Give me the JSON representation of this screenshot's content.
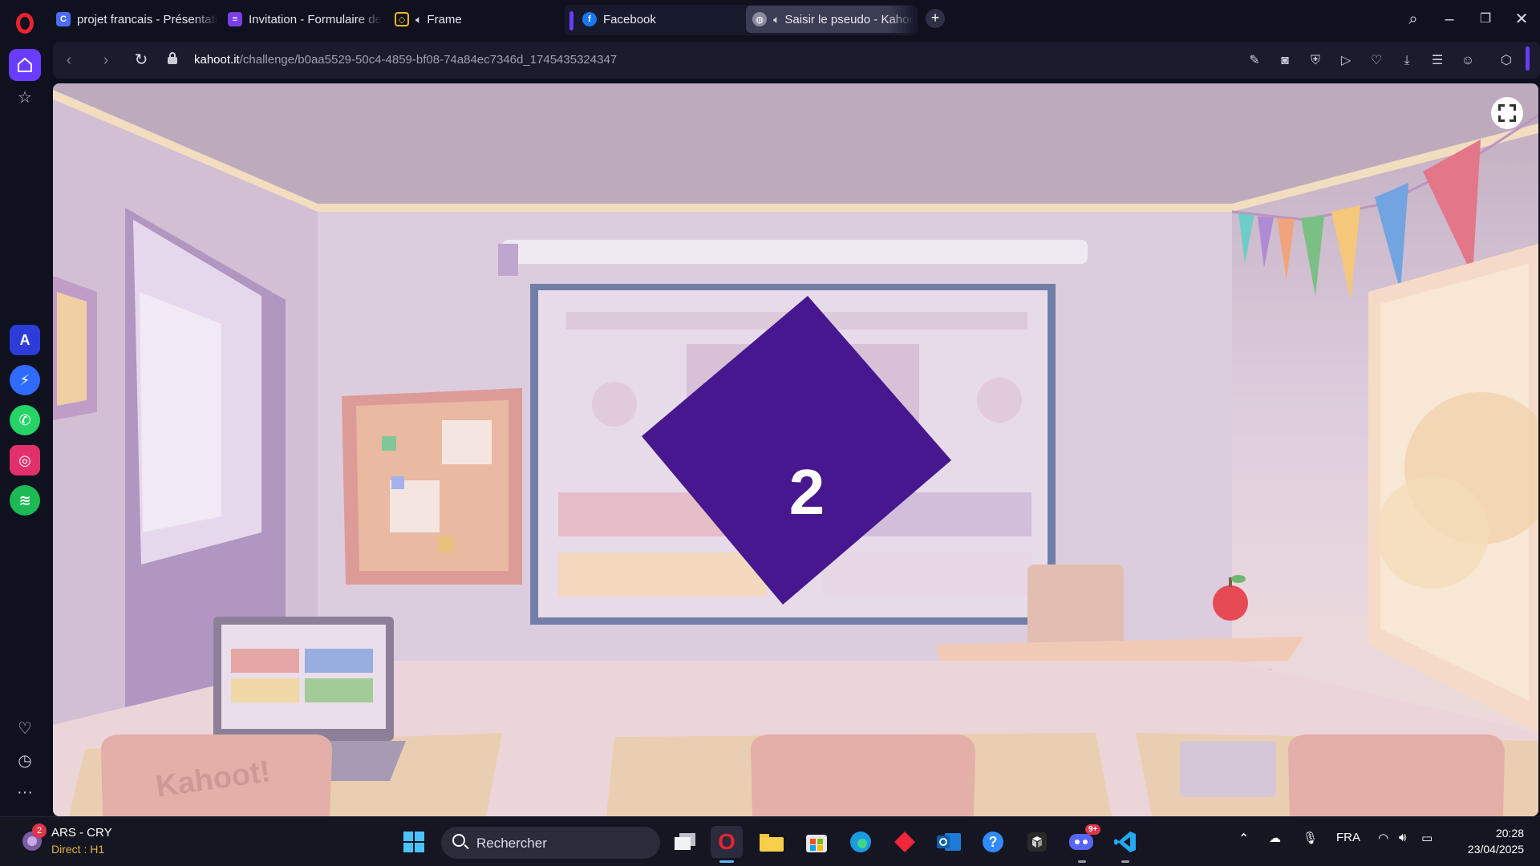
{
  "browser": {
    "tabs": [
      {
        "label": "projet francais - Présentati",
        "icon": "canva-icon",
        "color": "#4a6cf7"
      },
      {
        "label": "Invitation - Formulaire de",
        "icon": "forms-icon",
        "color": "#7b3fe4"
      },
      {
        "label": "Frame",
        "icon": "frame-icon",
        "color": "#f2b91c"
      },
      {
        "label": "Facebook",
        "icon": "facebook-icon",
        "color": "#1877f2"
      },
      {
        "label": "Saisir le pseudo - Kahoot",
        "icon": "globe-icon",
        "color": "#8a8c9e"
      }
    ],
    "active_tab_index": 4,
    "url_host": "kahoot.it",
    "url_path": "/challenge/b0aa5529-50c4-4859-bf08-74a84ec7346d_1745435324347",
    "accent": "#6a3cff"
  },
  "sidebar": {
    "apps": [
      {
        "name": "aria-icon",
        "color": "#2b3cd8"
      },
      {
        "name": "messenger-icon",
        "color": "#2f6bff"
      },
      {
        "name": "whatsapp-icon",
        "color": "#25d366"
      },
      {
        "name": "instagram-icon",
        "color": "#e1306c"
      },
      {
        "name": "spotify-icon",
        "color": "#1db954"
      }
    ]
  },
  "content": {
    "countdown_value": "2",
    "countdown_color": "#46178f",
    "chair_text": "Kahoot!"
  },
  "taskbar": {
    "news_title": "ARS - CRY",
    "news_subtitle": "Direct : H1",
    "news_badge": "2",
    "search_placeholder": "Rechercher",
    "discord_badge": "9+",
    "language": "FRA",
    "time": "20:28",
    "date": "23/04/2025"
  }
}
